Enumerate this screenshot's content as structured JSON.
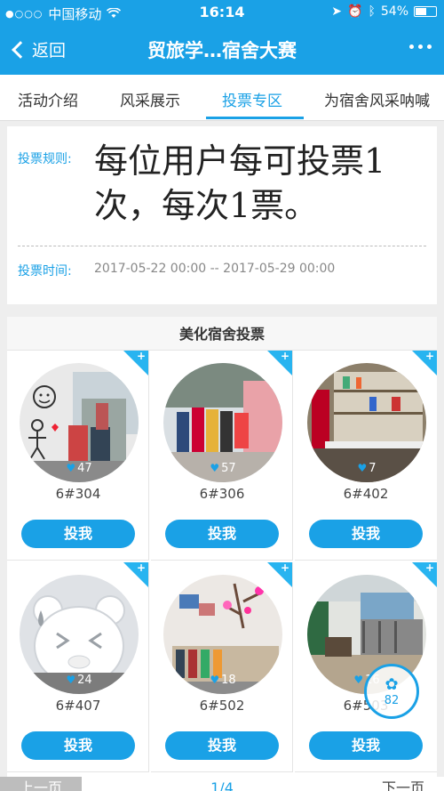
{
  "status_bar": {
    "signal": "●○○○",
    "carrier": "中国移动",
    "time": "16:14",
    "battery": "54%"
  },
  "nav": {
    "back_label": "返回",
    "title": "贸旅学…宿舍大赛"
  },
  "tabs": [
    {
      "label": "活动介绍"
    },
    {
      "label": "风采展示"
    },
    {
      "label": "投票专区"
    },
    {
      "label": "为宿舍风采呐喊"
    }
  ],
  "active_tab": "投票专区",
  "rules": {
    "rule_label": "投票规则:",
    "rule_text": "每位用户每可投票1次，每次1票。",
    "time_label": "投票时间:",
    "time_text": "2017-05-22 00:00 -- 2017-05-29 00:00"
  },
  "section_title": "美化宿舍投票",
  "entries": [
    {
      "room": "6#304",
      "likes": "47",
      "vote_label": "投我"
    },
    {
      "room": "6#306",
      "likes": "57",
      "vote_label": "投我"
    },
    {
      "room": "6#402",
      "likes": "7",
      "vote_label": "投我"
    },
    {
      "room": "6#407",
      "likes": "24",
      "vote_label": "投我"
    },
    {
      "room": "6#502",
      "likes": "18",
      "vote_label": "投我"
    },
    {
      "room": "6#503",
      "likes": "16",
      "vote_label": "投我"
    }
  ],
  "float_badge": {
    "count": "82"
  },
  "pager": {
    "prev_label": "上一页",
    "page": "1/4",
    "next_label": "下一页"
  },
  "colors": {
    "accent": "#1aa1e6",
    "corner": "#28b4f0"
  }
}
